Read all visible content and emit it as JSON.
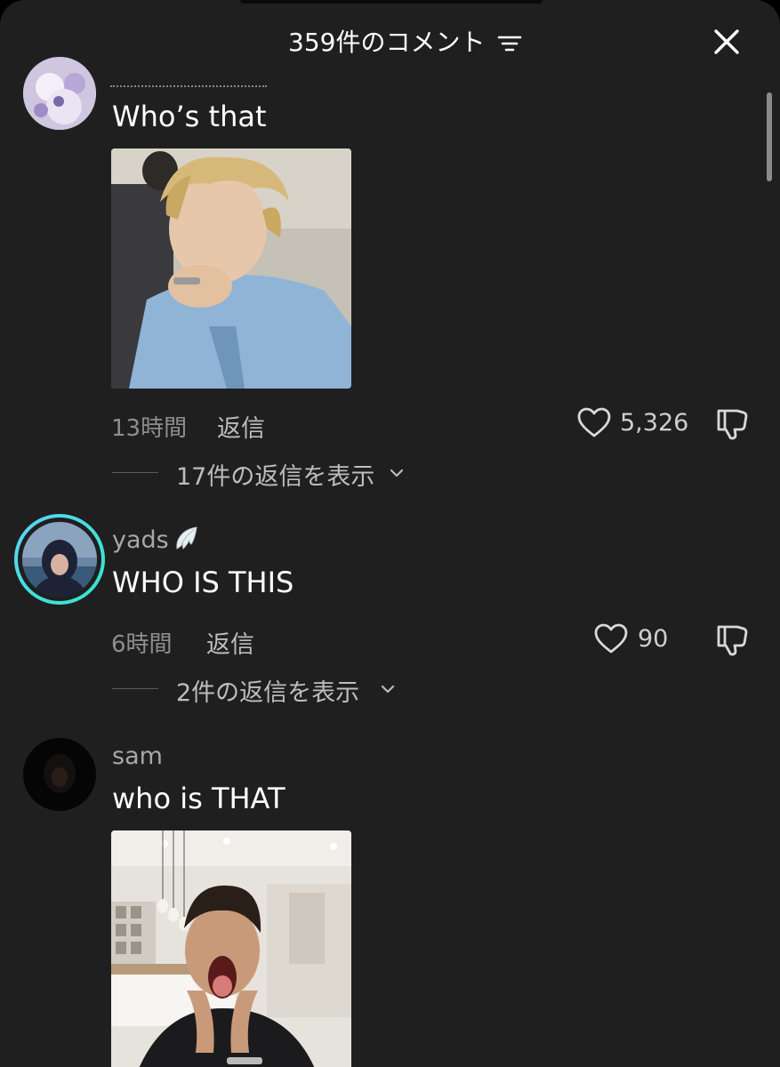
{
  "header": {
    "title": "359件のコメント",
    "filter_icon": "filter-icon",
    "close_icon": "close-icon"
  },
  "comments": [
    {
      "username": "",
      "text": "Who’s that",
      "has_image": true,
      "time": "13時間",
      "reply_label": "返信",
      "likes": "5,326",
      "view_replies": "17件の返信を表示"
    },
    {
      "username": "yads",
      "username_badge_icon": "wing-icon",
      "text": "WHO IS THIS",
      "has_image": false,
      "time": "6時間",
      "reply_label": "返信",
      "likes": "90",
      "view_replies": "2件の返信を表示"
    },
    {
      "username": "sam",
      "text": "who is THAT",
      "has_image": true
    }
  ],
  "colors": {
    "background": "#1f1f1f",
    "text_primary": "#ffffff",
    "text_secondary": "#a8a8a8",
    "story_ring_start": "#5fd3f5",
    "story_ring_end": "#2ee8c8"
  }
}
